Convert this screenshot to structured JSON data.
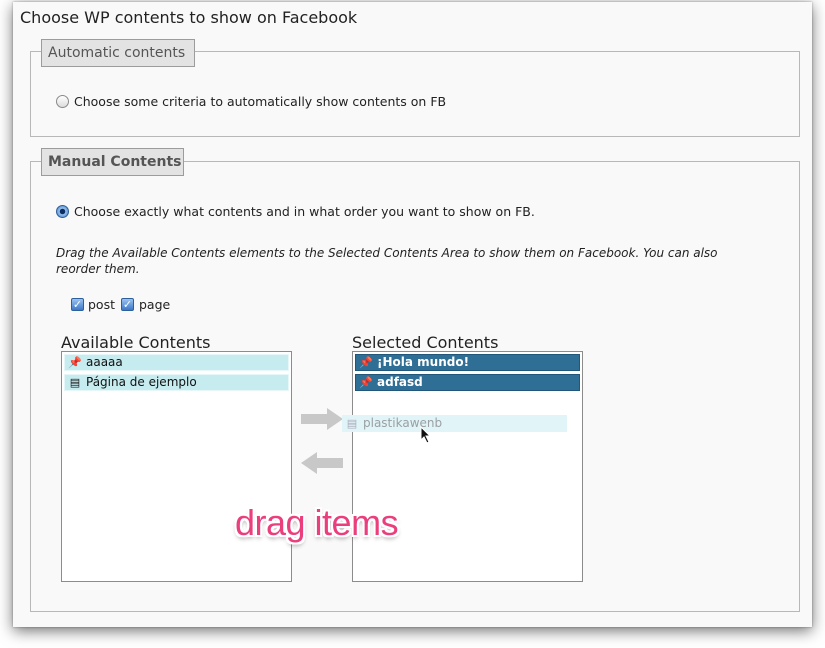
{
  "page": {
    "title": "Choose WP contents to show on Facebook"
  },
  "automatic": {
    "legend": "Automatic contents",
    "radio_label": "Choose some criteria to automatically show contents on FB",
    "selected": false
  },
  "manual": {
    "legend": "Manual Contents",
    "radio_label": "Choose exactly what contents and in what order you want to show on FB.",
    "selected": true,
    "hint": "Drag the Available Contents elements to the Selected Contents Area to show them on Facebook. You can also reorder them.",
    "filters": [
      {
        "label": "post",
        "checked": true
      },
      {
        "label": "page",
        "checked": true
      }
    ]
  },
  "available": {
    "title": "Available Contents",
    "items": [
      {
        "label": "aaaaa",
        "icon": "pin-icon"
      },
      {
        "label": "Página de ejemplo",
        "icon": "page-icon"
      }
    ]
  },
  "selected": {
    "title": "Selected Contents",
    "items": [
      {
        "label": "¡Hola mundo!",
        "icon": "pin-icon"
      },
      {
        "label": "adfasd",
        "icon": "pin-icon"
      }
    ]
  },
  "dragging": {
    "label": "plastikawenb",
    "icon": "page-icon"
  },
  "annotation": {
    "text": "drag items",
    "color": "#ea3f7c"
  },
  "colors": {
    "available_item": "#c6ecf0",
    "selected_item": "#2f6f95",
    "arrow": "#c8c8c8"
  }
}
